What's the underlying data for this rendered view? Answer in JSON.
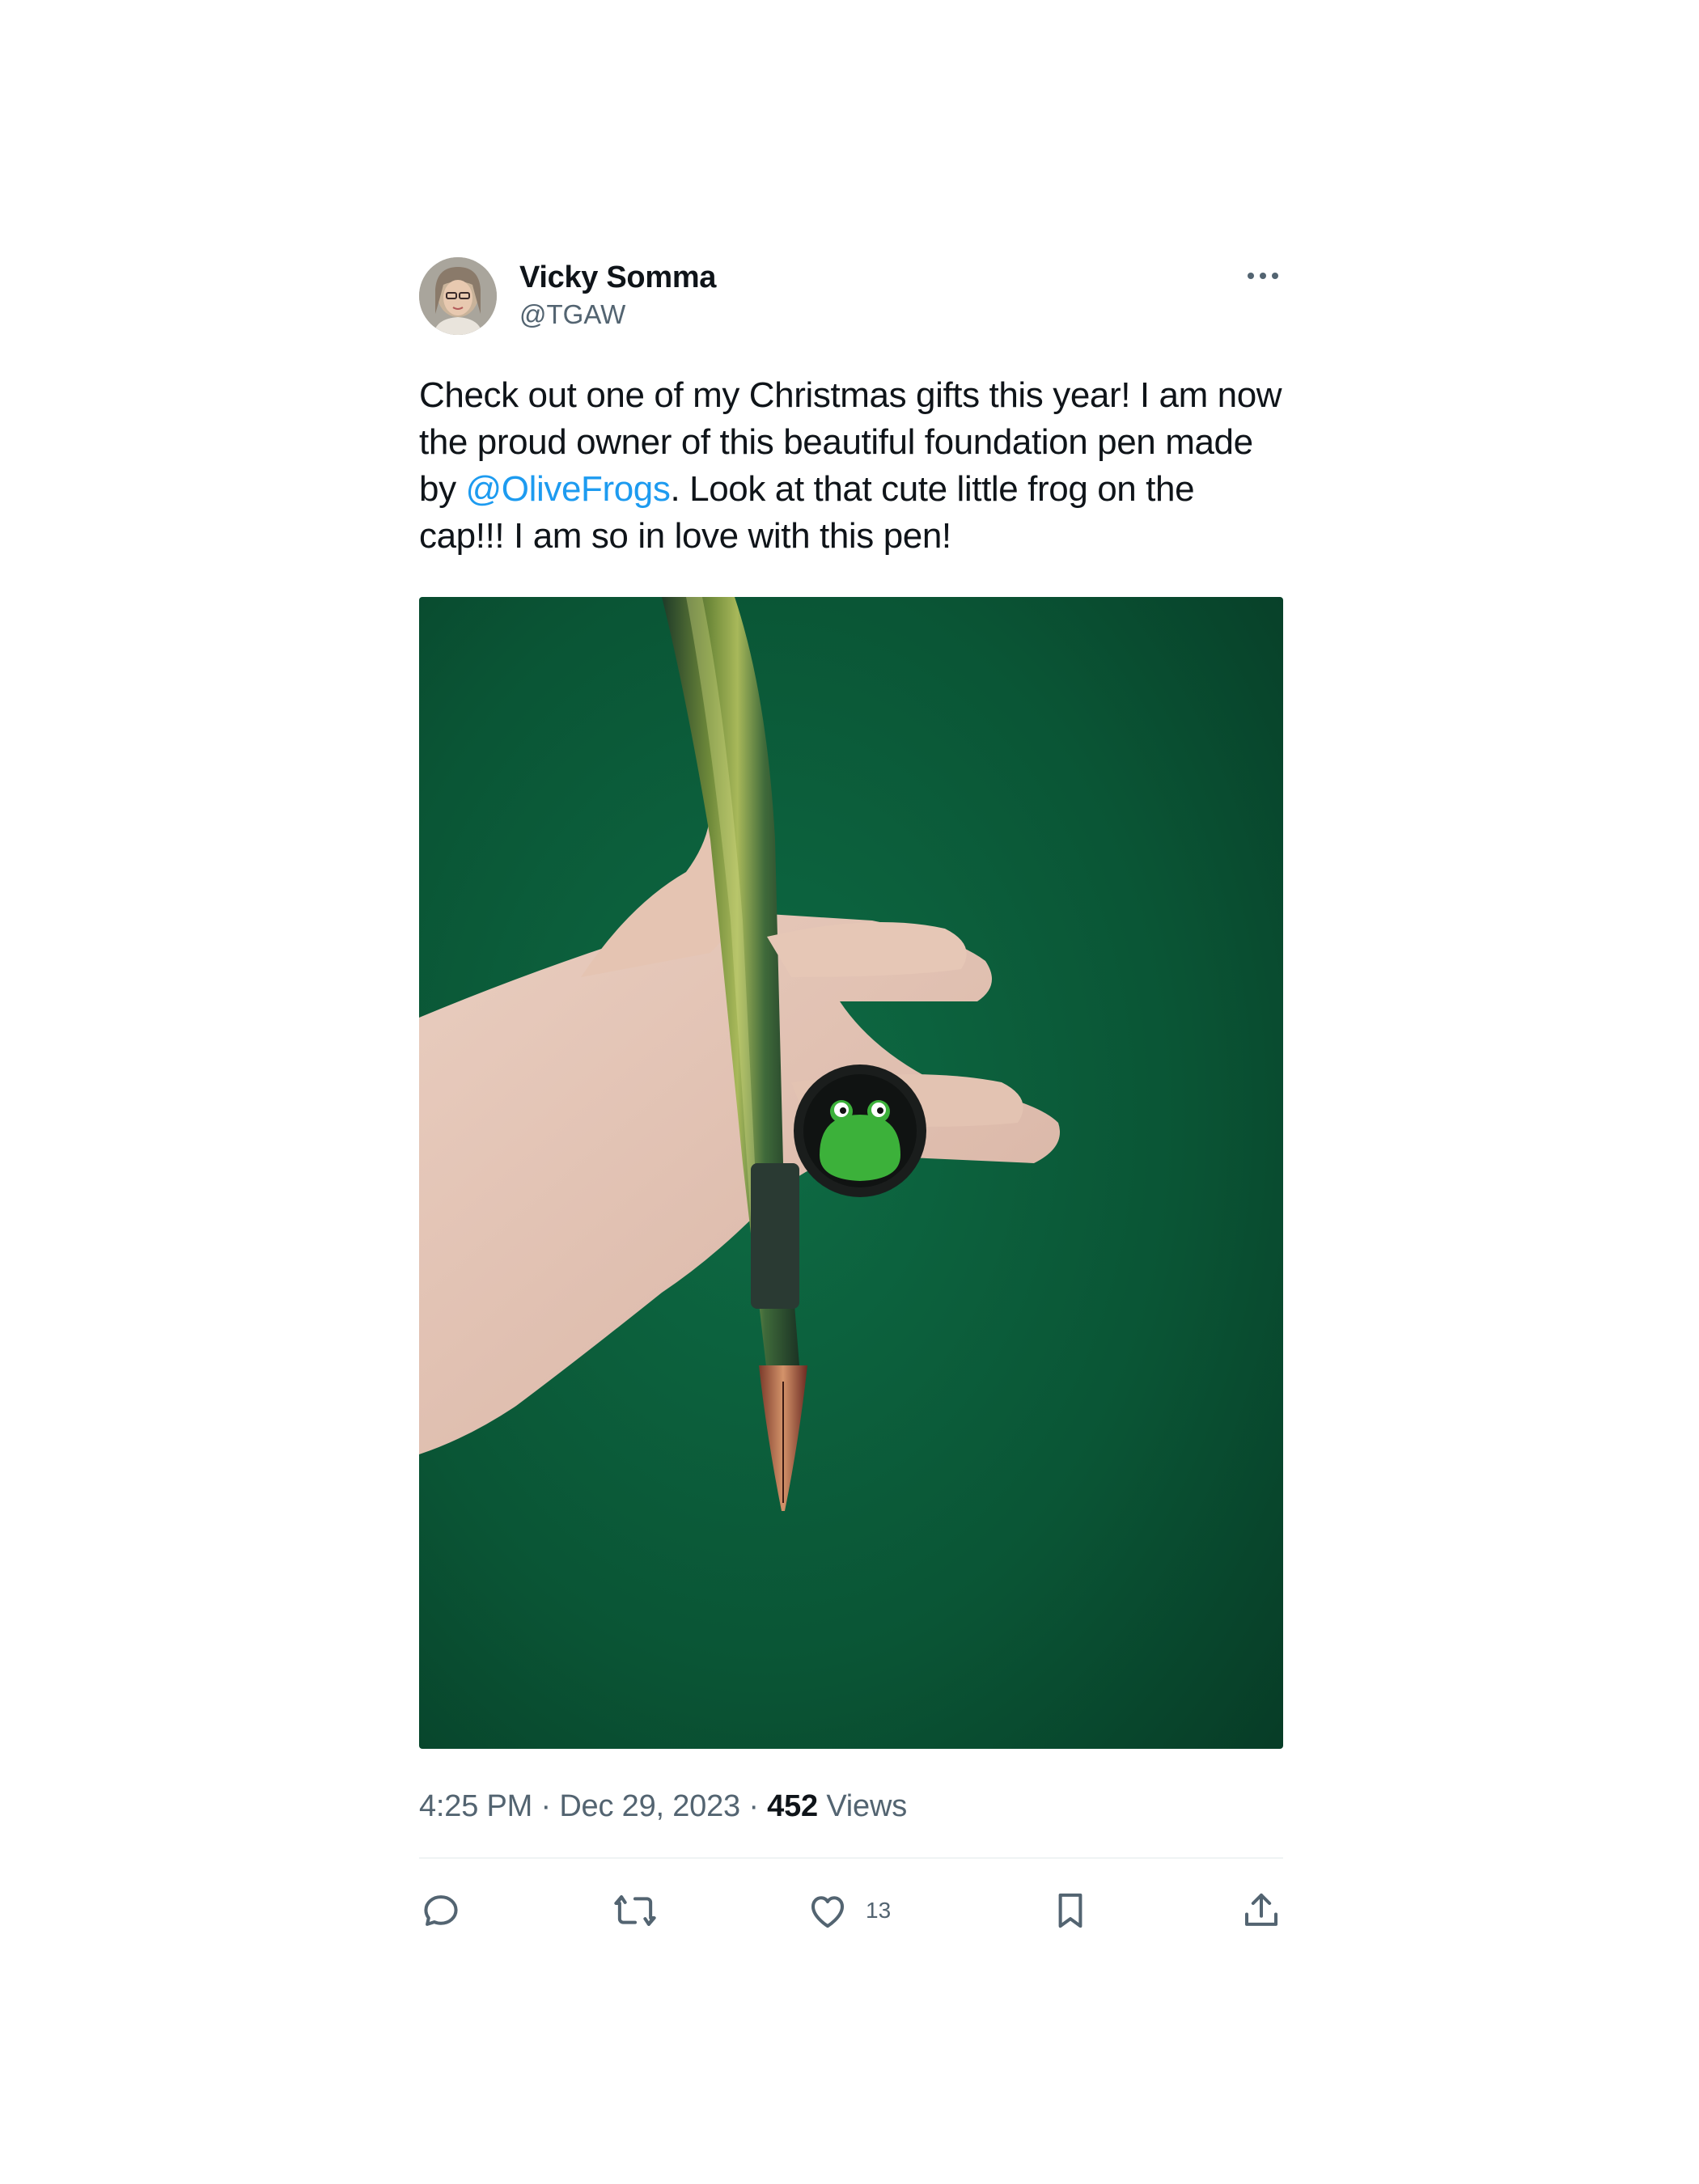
{
  "author": {
    "name": "Vicky Somma",
    "handle": "@TGAW",
    "avatar_icon": "user-avatar"
  },
  "tweet": {
    "text_before": "Check out one of my Christmas gifts this year! I am now the proud owner of this beautiful foundation pen made by ",
    "mention": "@OliveFrogs",
    "text_after": ". Look at that cute little frog on the cap!!! I am so in love with this pen!",
    "media_icon": "photo-hand-holding-fountain-pen"
  },
  "meta": {
    "time": "4:25 PM",
    "separator": "·",
    "date": "Dec 29, 2023",
    "views_count": "452",
    "views_label": "Views"
  },
  "actions": {
    "reply_icon": "reply-icon",
    "retweet_icon": "retweet-icon",
    "like_icon": "heart-icon",
    "like_count": "13",
    "bookmark_icon": "bookmark-icon",
    "share_icon": "share-icon",
    "more_icon": "more-icon"
  },
  "colors": {
    "mention": "#1d9bf0",
    "secondary_text": "#536471",
    "primary_text": "#0f1419",
    "background": "#ffffff",
    "photo_background": "#0c5a3a"
  }
}
